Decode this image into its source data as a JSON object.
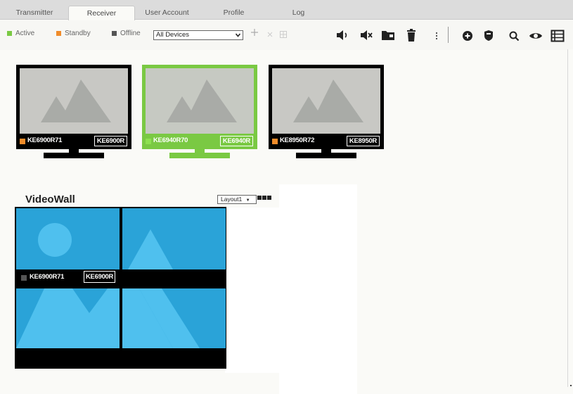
{
  "tabs": [
    {
      "label": "Transmitter",
      "active": false
    },
    {
      "label": "Receiver",
      "active": true
    },
    {
      "label": "User Account",
      "active": false
    },
    {
      "label": "Profile",
      "active": false
    },
    {
      "label": "Log",
      "active": false
    }
  ],
  "toolbar": {
    "legend": [
      {
        "label": "Active",
        "color": "#7ac943"
      },
      {
        "label": "Standby",
        "color": "#f08c2a"
      },
      {
        "label": "Offline",
        "color": "#555555"
      }
    ],
    "device_filter": {
      "selected": "All Devices"
    },
    "icons": [
      "add-plus-icon",
      "close-icon",
      "grid-icon",
      "volume-on-icon",
      "volume-mute-icon",
      "folder-icon",
      "trash-icon",
      "more-vertical-icon",
      "add-circle-icon",
      "shield-icon",
      "search-icon",
      "eye-icon",
      "list-view-icon"
    ]
  },
  "receivers": [
    {
      "name": "KE6900R71",
      "model": "KE6900R",
      "status": "standby",
      "status_color": "#f08c2a",
      "selected": false
    },
    {
      "name": "KE6940R70",
      "model": "KE6940R",
      "status": "active",
      "status_color": "#7ac943",
      "selected": true
    },
    {
      "name": "KE8950R72",
      "model": "KE8950R",
      "status": "standby",
      "status_color": "#f08c2a",
      "selected": false
    }
  ],
  "videowall": {
    "title": "VideoWall",
    "layout_selected": "Layout1",
    "layout_arrow": "▼",
    "label": {
      "name": "KE6900R71",
      "model": "KE6900R",
      "status": "offline",
      "status_color": "#555555"
    },
    "tile_color": "#2aa3d8"
  },
  "colors": {
    "accent_green": "#7ac943",
    "standby_orange": "#f08c2a",
    "tab_bar": "#dcdcdc"
  }
}
